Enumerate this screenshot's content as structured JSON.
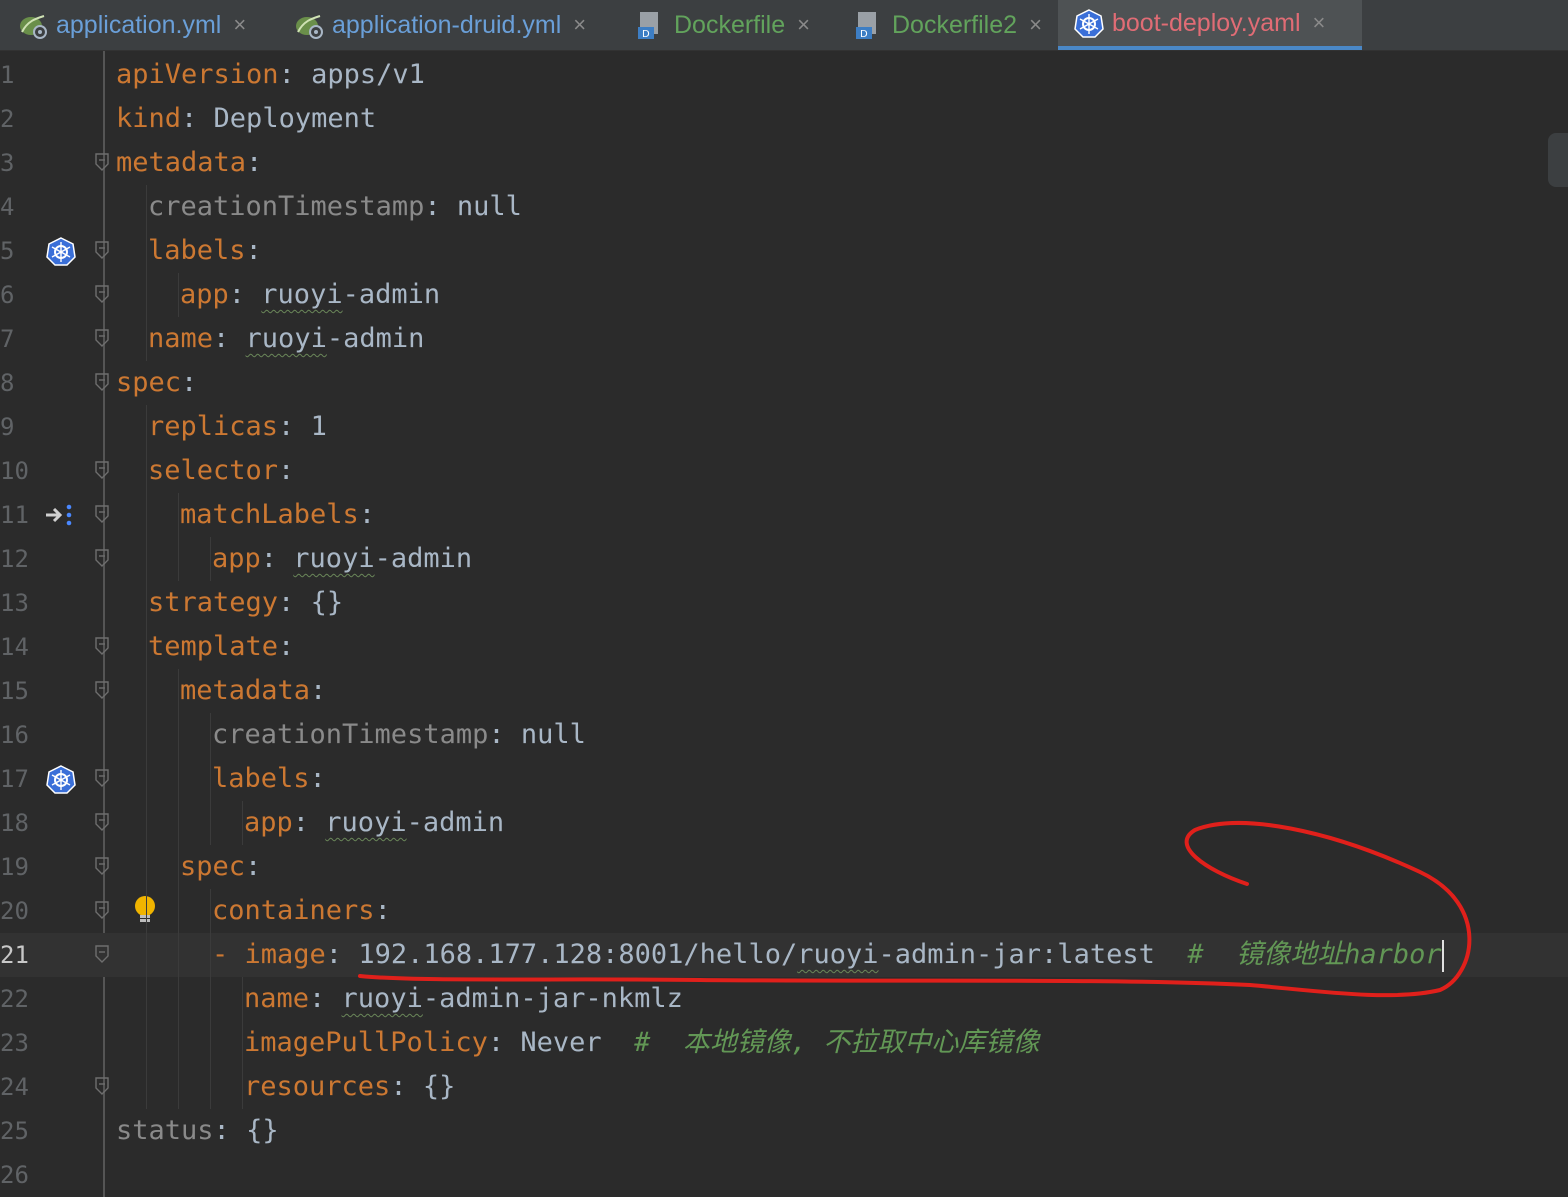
{
  "tabs": [
    {
      "label": "application.yml",
      "icon": "spring-leaf-icon",
      "color": "#6a9fd8",
      "active": false
    },
    {
      "label": "application-druid.yml",
      "icon": "spring-leaf-icon",
      "color": "#6a9fd8",
      "active": false
    },
    {
      "label": "Dockerfile",
      "icon": "docker-file-icon",
      "color": "#62a35c",
      "active": false
    },
    {
      "label": "Dockerfile2",
      "icon": "docker-file-icon",
      "color": "#62a35c",
      "active": false
    },
    {
      "label": "boot-deploy.yaml",
      "icon": "kubernetes-icon",
      "color": "#e06c75",
      "active": true
    }
  ],
  "close_glyph": "×",
  "lines": [
    {
      "n": "1",
      "indent": 0,
      "key": "apiVersion",
      "sep": ": ",
      "value": "apps/v1"
    },
    {
      "n": "2",
      "indent": 0,
      "key": "kind",
      "sep": ": ",
      "value": "Deployment"
    },
    {
      "n": "3",
      "indent": 0,
      "key": "metadata",
      "sep": ":",
      "value": ""
    },
    {
      "n": "4",
      "indent": 1,
      "key": "creationTimestamp",
      "sep": ": ",
      "value": "null",
      "keyGray": true
    },
    {
      "n": "5",
      "indent": 1,
      "key": "labels",
      "sep": ":",
      "value": "",
      "gutterIcon": "kubernetes-icon"
    },
    {
      "n": "6",
      "indent": 2,
      "key": "app",
      "sep": ": ",
      "value": "ruoyi-admin",
      "squiggle": "ruoyi"
    },
    {
      "n": "7",
      "indent": 1,
      "key": "name",
      "sep": ": ",
      "value": "ruoyi-admin",
      "squiggle": "ruoyi"
    },
    {
      "n": "8",
      "indent": 0,
      "key": "spec",
      "sep": ":",
      "value": ""
    },
    {
      "n": "9",
      "indent": 1,
      "key": "replicas",
      "sep": ": ",
      "value": "1"
    },
    {
      "n": "10",
      "indent": 1,
      "key": "selector",
      "sep": ":",
      "value": ""
    },
    {
      "n": "11",
      "indent": 2,
      "key": "matchLabels",
      "sep": ":",
      "value": "",
      "gutterIcon": "navigate-arrow-icon"
    },
    {
      "n": "12",
      "indent": 3,
      "key": "app",
      "sep": ": ",
      "value": "ruoyi-admin",
      "squiggle": "ruoyi"
    },
    {
      "n": "13",
      "indent": 1,
      "key": "strategy",
      "sep": ": ",
      "value": "{}"
    },
    {
      "n": "14",
      "indent": 1,
      "key": "template",
      "sep": ":",
      "value": ""
    },
    {
      "n": "15",
      "indent": 2,
      "key": "metadata",
      "sep": ":",
      "value": ""
    },
    {
      "n": "16",
      "indent": 3,
      "key": "creationTimestamp",
      "sep": ": ",
      "value": "null",
      "keyGray": true
    },
    {
      "n": "17",
      "indent": 3,
      "key": "labels",
      "sep": ":",
      "value": "",
      "gutterIcon": "kubernetes-icon"
    },
    {
      "n": "18",
      "indent": 4,
      "key": "app",
      "sep": ": ",
      "value": "ruoyi-admin",
      "squiggle": "ruoyi"
    },
    {
      "n": "19",
      "indent": 2,
      "key": "spec",
      "sep": ":",
      "value": ""
    },
    {
      "n": "20",
      "indent": 3,
      "key": "containers",
      "sep": ":",
      "value": "",
      "bulb": true
    },
    {
      "n": "21",
      "indent": 3,
      "dash": true,
      "key": "image",
      "sep": ": ",
      "value": "192.168.177.128:8001/hello/ruoyi-admin-jar:latest",
      "squiggle": "ruoyi",
      "comment": "  #  镜像地址harbor",
      "current": true,
      "caret": true
    },
    {
      "n": "22",
      "indent": 4,
      "key": "name",
      "sep": ": ",
      "value": "ruoyi-admin-jar-nkmlz",
      "squiggle": "ruoyi"
    },
    {
      "n": "23",
      "indent": 4,
      "key": "imagePullPolicy",
      "sep": ": ",
      "value": "Never",
      "comment": "  #  本地镜像, 不拉取中心库镜像"
    },
    {
      "n": "24",
      "indent": 4,
      "key": "resources",
      "sep": ": ",
      "value": "{}"
    },
    {
      "n": "25",
      "indent": 0,
      "key": "status",
      "sep": ": ",
      "value": "{}",
      "keyGray": true
    },
    {
      "n": "26",
      "indent": 0,
      "key": "",
      "sep": "",
      "value": ""
    }
  ],
  "colors": {
    "key": "#cc7832",
    "value": "#a9b7c6",
    "comment": "#629755",
    "annotation": "#e0201b"
  }
}
